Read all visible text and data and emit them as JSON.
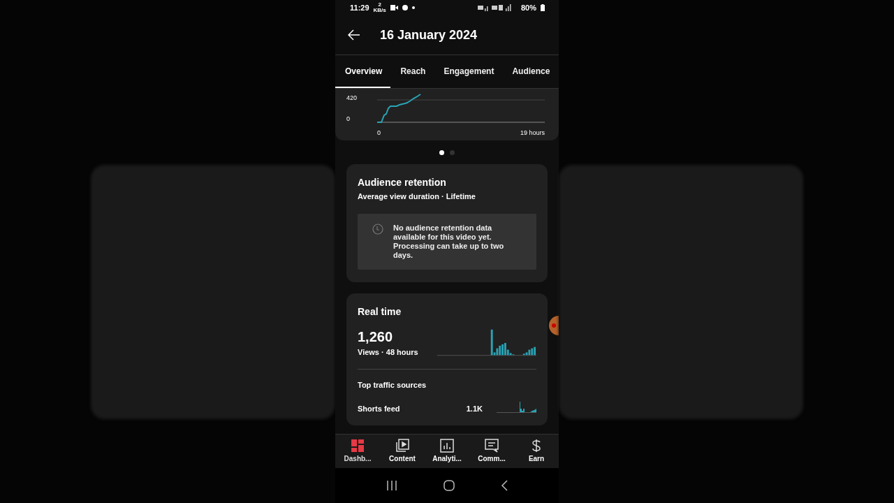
{
  "status_bar": {
    "time": "11:29",
    "net_speed": "2",
    "net_unit": "KB/s",
    "battery": "80%"
  },
  "header": {
    "title": "16 January 2024"
  },
  "tabs": [
    {
      "label": "Overview",
      "selected": true
    },
    {
      "label": "Reach",
      "selected": false
    },
    {
      "label": "Engagement",
      "selected": false
    },
    {
      "label": "Audience",
      "selected": false
    }
  ],
  "views_chart": {
    "y_labels": [
      "420",
      "0"
    ],
    "x_labels": [
      "0",
      "19 hours"
    ]
  },
  "pager": [
    {
      "selected": true
    },
    {
      "selected": false
    }
  ],
  "retention_card": {
    "title": "Audience retention",
    "subtitle": "Average view duration · Lifetime",
    "message": "No audience retention data available for this video yet. Processing can take up to two days."
  },
  "realtime_card": {
    "title": "Real time",
    "views": "1,260",
    "views_caption": "Views · 48 hours",
    "traffic_title": "Top traffic sources",
    "sources": [
      {
        "name": "Shorts feed",
        "value": "1.1K"
      }
    ]
  },
  "bottom_nav": [
    {
      "label": "Dashb...",
      "kind": "dashboard",
      "selected": true
    },
    {
      "label": "Content",
      "kind": "content",
      "selected": false
    },
    {
      "label": "Analyti...",
      "kind": "analytics",
      "selected": false
    },
    {
      "label": "Comm...",
      "kind": "comments",
      "selected": false
    },
    {
      "label": "Earn",
      "kind": "earn",
      "selected": false
    }
  ]
}
